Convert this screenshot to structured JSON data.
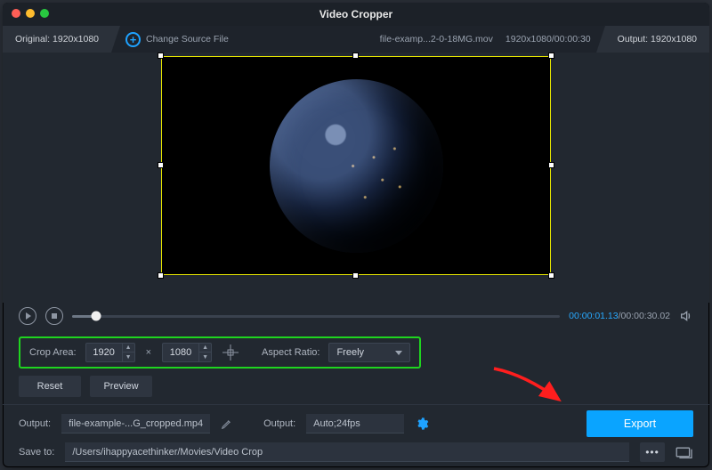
{
  "title": "Video Cropper",
  "infobar": {
    "original_label": "Original:",
    "original_value": "1920x1080",
    "change_source": "Change Source File",
    "filename": "file-examp...2-0-18MG.mov",
    "src_res_dur": "1920x1080/00:00:30",
    "output_label": "Output:",
    "output_value": "1920x1080"
  },
  "transport": {
    "current": "00:00:01.13",
    "total": "/00:00:30.02"
  },
  "crop": {
    "area_label": "Crop Area:",
    "w": "1920",
    "h": "1080",
    "ratio_label": "Aspect Ratio:",
    "ratio_value": "Freely"
  },
  "buttons": {
    "reset": "Reset",
    "preview": "Preview",
    "export": "Export"
  },
  "output": {
    "file_label": "Output:",
    "file_value": "file-example-...G_cropped.mp4",
    "fmt_label": "Output:",
    "fmt_value": "Auto;24fps"
  },
  "saveto": {
    "label": "Save to:",
    "path": "/Users/ihappyacethinker/Movies/Video Crop"
  }
}
